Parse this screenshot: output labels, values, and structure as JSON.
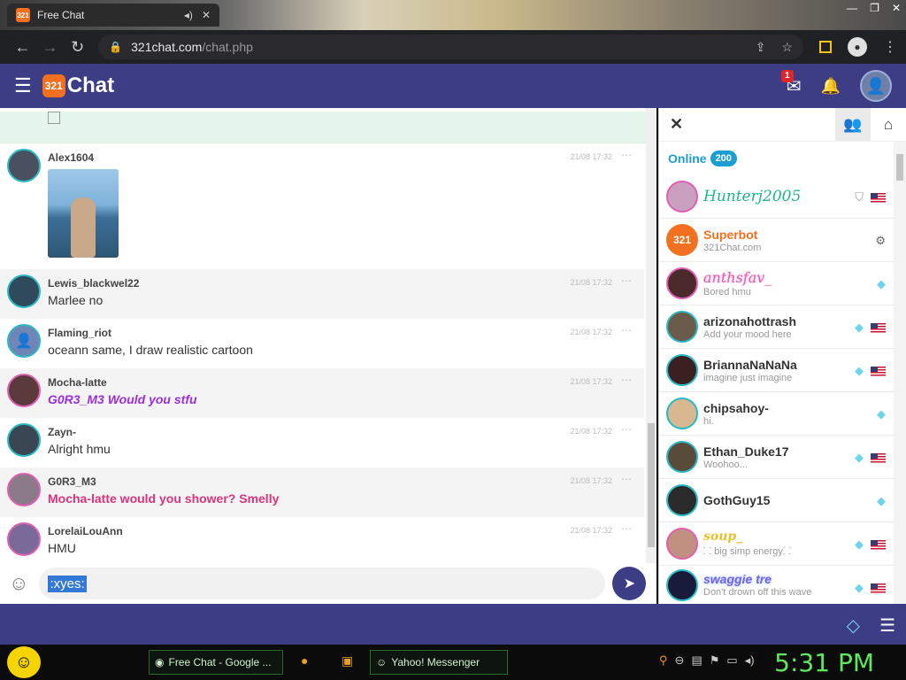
{
  "browser": {
    "tab_title": "Free Chat",
    "url_host": "321chat.com",
    "url_path": "/chat.php"
  },
  "app": {
    "logo_badge": "321",
    "logo_word": "Chat",
    "mail_count": "1"
  },
  "messages": [
    {
      "user": "Alex1604",
      "time": "21/08 17:32",
      "text": "",
      "has_photo": true
    },
    {
      "user": "Lewis_blackwel22",
      "time": "21/08 17:32",
      "text": "Marlee no"
    },
    {
      "user": "Flaming_riot",
      "time": "21/08 17:32",
      "text": "oceann same, I draw realistic cartoon"
    },
    {
      "user": "Mocha-latte",
      "time": "21/08 17:32",
      "text": "G0R3_M3 Would you stfu"
    },
    {
      "user": "Zayn-",
      "time": "21/08 17:32",
      "text": "Alright hmu"
    },
    {
      "user": "G0R3_M3",
      "time": "21/08 17:32",
      "text": "Mocha-latte would you shower? Smelly"
    },
    {
      "user": "LorelaiLouAnn",
      "time": "21/08 17:32",
      "text": "HMU"
    }
  ],
  "input": {
    "value": ":xyes:"
  },
  "sidebar": {
    "online_label": "Online",
    "online_count": "200",
    "users": [
      {
        "name": "Hunterj2005",
        "status": ""
      },
      {
        "name": "Superbot",
        "status": "321Chat.com"
      },
      {
        "name": "anthsfav_",
        "status": "Bored hmu"
      },
      {
        "name": "arizonahottrash",
        "status": "Add your mood here"
      },
      {
        "name": "BriannaNaNaNa",
        "status": "imagine just imagine"
      },
      {
        "name": "chipsahoy-",
        "status": "hi."
      },
      {
        "name": "Ethan_Duke17",
        "status": "Woohoo..."
      },
      {
        "name": "GothGuy15",
        "status": ""
      },
      {
        "name": "soup_",
        "status": "⸬ big simp energy⸬"
      },
      {
        "name": "swaggie tre",
        "status": "Don't drown off this wave"
      }
    ]
  },
  "taskbar": {
    "task1": "Free Chat - Google ...",
    "task2": "Yahoo! Messenger",
    "clock": "5:31 PM"
  },
  "colors": {
    "header": "#3d3d85",
    "accent": "#1c9fd0",
    "brand_orange": "#f37021"
  }
}
